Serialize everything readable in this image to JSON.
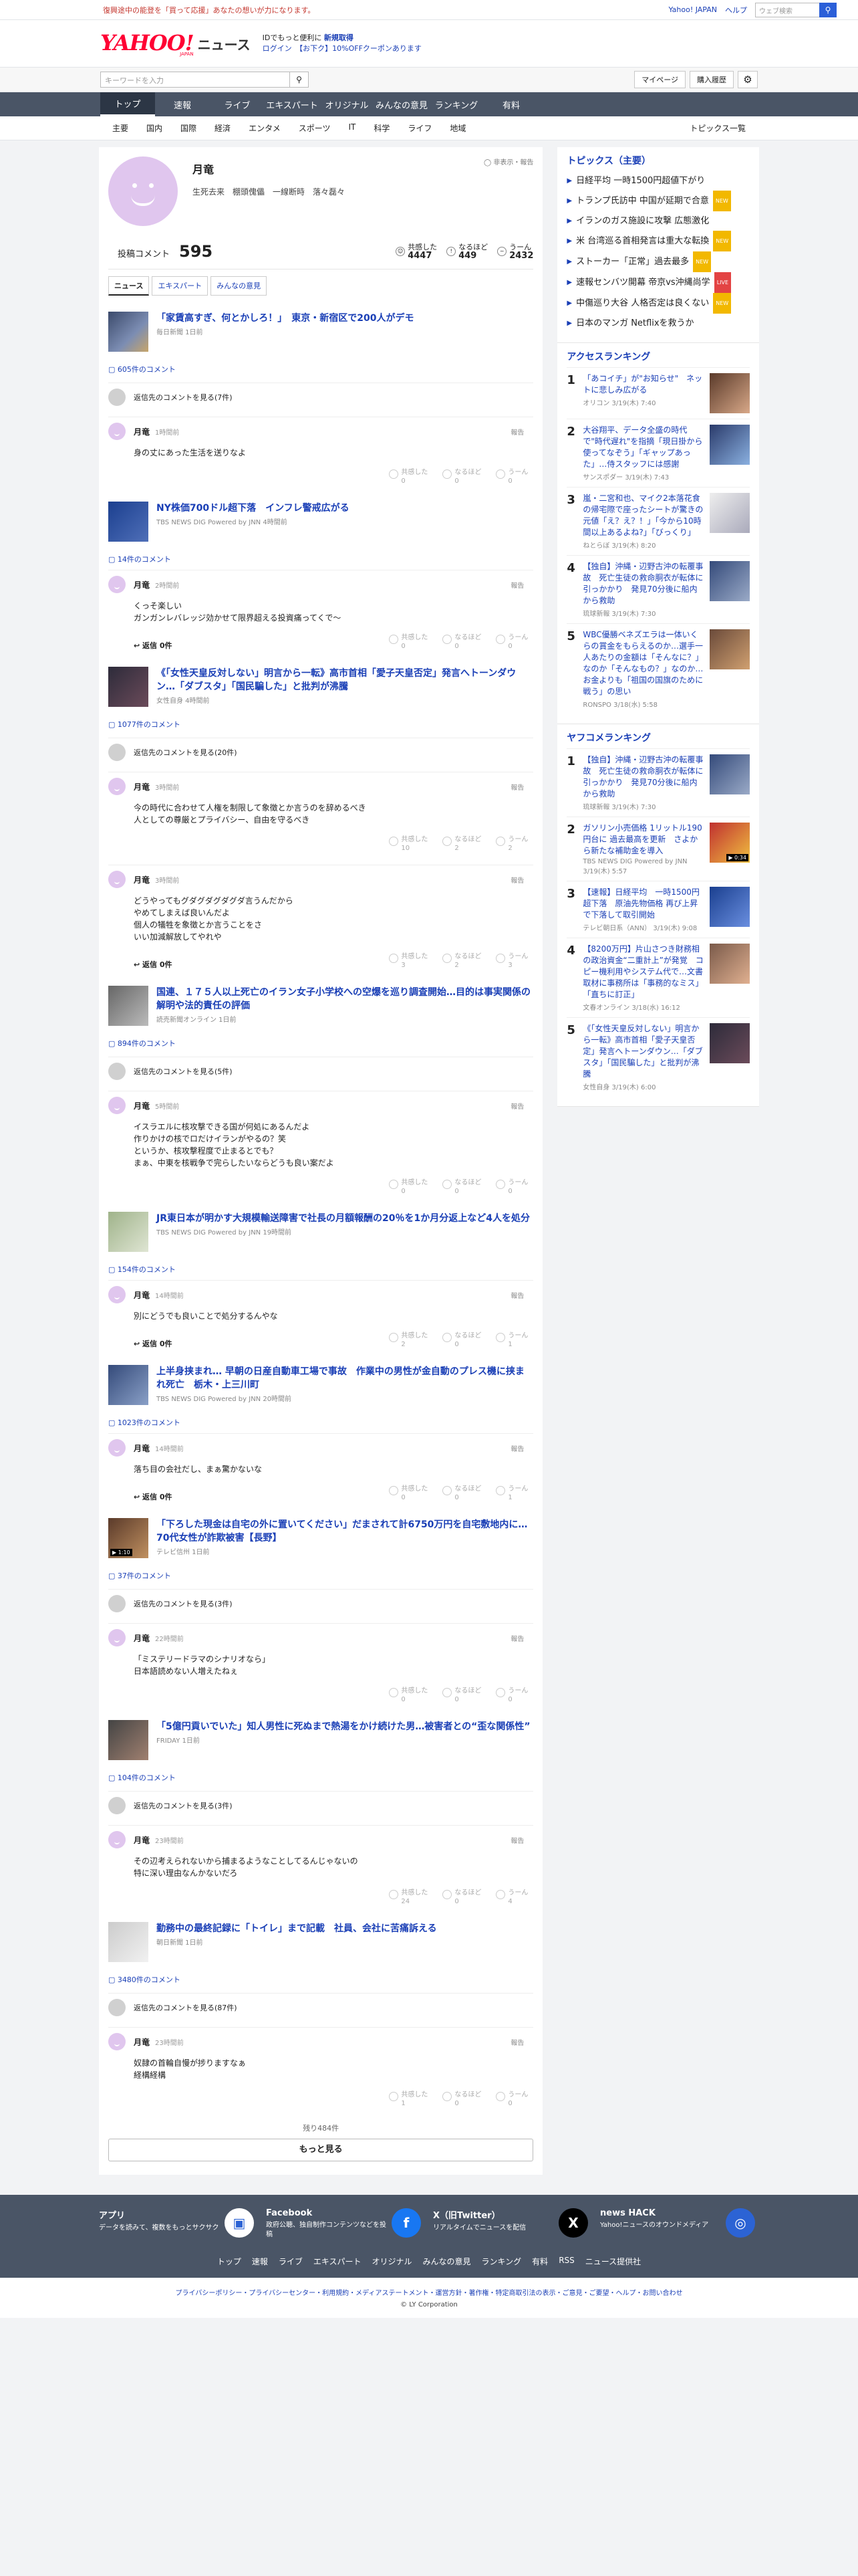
{
  "topbar": {
    "notice": "復興途中の能登を「買って応援」あなたの想いが力になります。",
    "yahoo_japan": "Yahoo! JAPAN",
    "help": "ヘルプ",
    "search_placeholder": "ウェブ検索",
    "search_btn": "Q"
  },
  "masthead": {
    "logo_text": "YAHOO!",
    "logo_sub": "JAPAN",
    "service": "ニュース",
    "promo_line1_prefix": "IDでもっと便利に",
    "promo_line1_link": "新規取得",
    "promo_login": "ログイン",
    "promo_offer": "【お下ク】10%OFFクーポンあります"
  },
  "searchbar": {
    "placeholder": "キーワードを入力",
    "my_page": "マイページ",
    "history": "購入履歴"
  },
  "global_nav": [
    "トップ",
    "速報",
    "ライブ",
    "エキスパート",
    "オリジナル",
    "みんなの意見",
    "ランキング",
    "有料"
  ],
  "sub_nav": [
    "主要",
    "国内",
    "国際",
    "経済",
    "エンタメ",
    "スポーツ",
    "IT",
    "科学",
    "ライフ",
    "地域"
  ],
  "sub_nav_right": "トピックス一覧",
  "profile": {
    "name": "月竜",
    "tagline": "生死去来　棚頭傀儡　一線断時　落々磊々",
    "privacy": "非表示・報告",
    "comment_label": "投稿コメント",
    "comment_count": "595",
    "reactions": [
      {
        "label": "共感した",
        "value": "4447"
      },
      {
        "label": "なるほど",
        "value": "449"
      },
      {
        "label": "うーん",
        "value": "2432"
      }
    ]
  },
  "tabs": [
    "ニュース",
    "エキスパート",
    "みんなの意見"
  ],
  "articles": [
    {
      "title": "「家賃高すぎ、何とかしろ！」　東京・新宿区で200人がデモ",
      "source": "毎日新聞 1日前",
      "count": "605件のコメント",
      "reply_view": "返信先のコメントを見る(7件)",
      "comments": [
        {
          "name": "月竜",
          "time": "1時間前",
          "text": "身の丈にあった生活を送りなよ",
          "reply": "",
          "r": [
            "0",
            "0",
            "0"
          ]
        }
      ]
    },
    {
      "title": "NY株価700ドル超下落　インフレ警戒広がる",
      "source": "TBS NEWS DIG Powered by JNN 4時間前",
      "count": "14件のコメント",
      "reply_view": "",
      "comments": [
        {
          "name": "月竜",
          "time": "2時間前",
          "text": "くっそ楽しい\nガンガンレバレッジ効かせて限界超える投資痛ってくで〜",
          "reply": "返信 0件",
          "r": [
            "0",
            "0",
            "0"
          ]
        }
      ]
    },
    {
      "title": "《「女性天皇反対しない」明言から一転》高市首相「愛子天皇否定」発言へトーンダウン…「ダブスタ」「国民騙した」と批判が沸騰",
      "source": "女性自身 4時間前",
      "count": "1077件のコメント",
      "reply_view": "返信先のコメントを見る(20件)",
      "comments": [
        {
          "name": "月竜",
          "time": "3時間前",
          "text": "今の時代に合わせて人権を制限して象徴とか言うのを辞めるべき\n人としての尊厳とプライバシー、自由を守るべき",
          "reply": "",
          "r": [
            "10",
            "2",
            "2"
          ]
        },
        {
          "name": "月竜",
          "time": "3時間前",
          "text": "どうやってもグダグダグダグダ言うんだから\nやめてしまえば良いんだよ\n個人の犠牲を象徴とか言うことをさ\nいい加減解放してやれや",
          "reply": "返信 0件",
          "r": [
            "3",
            "2",
            "3"
          ]
        }
      ]
    },
    {
      "title": "国連、１７５人以上死亡のイラン女子小学校への空爆を巡り調査開始…目的は事実関係の解明や法的責任の評価",
      "source": "読売新聞オンライン 1日前",
      "count": "894件のコメント",
      "reply_view": "返信先のコメントを見る(5件)",
      "comments": [
        {
          "name": "月竜",
          "time": "5時間前",
          "text": "イスラエルに核攻撃できる国が何処にあるんだよ\n作りかけの核でロだけイランがやるの？笑\nというか、核攻撃程度で止まるとでも？\nまぁ、中東を核戦争で完らしたいならどうも良い案だよ",
          "reply": "",
          "r": [
            "0",
            "0",
            "0"
          ]
        }
      ]
    },
    {
      "title": "JR東日本が明かす大規模輸送障害で社長の月額報酬の20％を1か月分返上など4人を処分",
      "source": "TBS NEWS DIG Powered by JNN 19時間前",
      "count": "154件のコメント",
      "reply_view": "",
      "comments": [
        {
          "name": "月竜",
          "time": "14時間前",
          "text": "別にどうでも良いことで処分するんやな",
          "reply": "返信 0件",
          "r": [
            "2",
            "0",
            "1"
          ]
        }
      ]
    },
    {
      "title": "上半身挟まれ… 早朝の日産自動車工場で事故　作業中の男性が金自動のプレス機に挟まれ死亡　栃木・上三川町",
      "source": "TBS NEWS DIG Powered by JNN 20時間前",
      "count": "1023件のコメント",
      "reply_view": "",
      "comments": [
        {
          "name": "月竜",
          "time": "14時間前",
          "text": "落ち目の会社だし、まぁ驚かないな",
          "reply": "返信 0件",
          "r": [
            "0",
            "0",
            "1"
          ]
        }
      ]
    },
    {
      "title": "「下ろした現金は自宅の外に置いてください」だまされて計6750万円を自宅敷地内に…70代女性が詐欺被害【長野】",
      "source": "テレビ信州 1日前",
      "count": "37件のコメント",
      "reply_view": "返信先のコメントを見る(3件)",
      "comments": [
        {
          "name": "月竜",
          "time": "22時間前",
          "text": "「ミステリードラマのシナリオなら」\n日本語読めない人増えたねぇ",
          "reply": "",
          "r": [
            "0",
            "0",
            "0"
          ]
        }
      ]
    },
    {
      "title": "「5億円貢いでいた」知人男性に死ぬまで熱湯をかけ続けた男…被害者との“歪な関係性”",
      "source": "FRIDAY 1日前",
      "count": "104件のコメント",
      "reply_view": "返信先のコメントを見る(3件)",
      "comments": [
        {
          "name": "月竜",
          "time": "23時間前",
          "text": "その辺考えられないから捕まるようなことしてるんじゃないの\n特に深い理由なんかないだろ",
          "reply": "",
          "r": [
            "24",
            "0",
            "4"
          ]
        }
      ]
    },
    {
      "title": "勤務中の最終記録に「トイレ」まで記載　社員、会社に苦痛訴える",
      "source": "朝日新聞 1日前",
      "count": "3480件のコメント",
      "reply_view": "返信先のコメントを見る(87件)",
      "comments": [
        {
          "name": "月竜",
          "time": "23時間前",
          "text": "奴隷の首輪自慢が捗りますなぁ\n経構経構",
          "reply": "",
          "r": [
            "1",
            "0",
            "0"
          ]
        }
      ]
    }
  ],
  "reaction_labels": [
    "共感した",
    "なるほど",
    "うーん"
  ],
  "report": "報告",
  "more": {
    "remaining": "残り484件",
    "button": "もっと見る"
  },
  "topics": {
    "header": "トピックス（主要）",
    "items": [
      {
        "t": "日経平均 一時1500円超値下がり",
        "b": ""
      },
      {
        "t": "トランプ氏訪中 中国が延期で合意",
        "b": "NEW"
      },
      {
        "t": "イランのガス施設に攻撃 広態激化",
        "b": ""
      },
      {
        "t": "米 台湾巡る首相発言は重大な転換",
        "b": "NEW"
      },
      {
        "t": "ストーカー「正常」過去最多",
        "b": "NEW"
      },
      {
        "t": "速報センバツ開幕 帝京vs沖縄尚学",
        "b": "LIVE"
      },
      {
        "t": "中傷巡り大谷 人格否定は良くない",
        "b": "NEW"
      },
      {
        "t": "日本のマンガ Netflixを救うか",
        "b": ""
      }
    ]
  },
  "access_ranking": {
    "header": "アクセスランキング",
    "items": [
      {
        "n": "1",
        "t": "「あコイチ」が\"お知らせ\"　ネットに悲しみ広がる",
        "s": "オリコン 3/19(木) 7:40"
      },
      {
        "n": "2",
        "t": "大谷翔平、データ全盛の時代で\"時代遅れ\"を指摘「現日掛から使ってなぞう」「ギャップあった」…侍スタッフには感謝",
        "s": "サンスポダー 3/19(木) 7:43"
      },
      {
        "n": "3",
        "t": "嵐・二宮和也、マイク2本落花食の帰宅際で座ったシートが驚きの元値「え？え？！」「今から10時間以上あるよね?」「びっくり」",
        "s": "ねとらぼ 3/19(木) 8:20"
      },
      {
        "n": "4",
        "t": "【独自】沖縄・辺野古沖の転覆事故　死亡生徒の救命胴衣が転体に引っかかり　発見70分後に船内から救助",
        "s": "琉球新報 3/19(木) 7:30"
      },
      {
        "n": "5",
        "t": "WBC優勝ベネズエラは一体いくらの賞金をもらえるのか…選手一人あたりの金額は「そんなに？」なのか「そんなもの？」なのか…お金よりも「祖国の国旗のために戦う」の思い",
        "s": "RONSPO 3/18(水) 5:58"
      }
    ]
  },
  "yahoo_ranking": {
    "header": "ヤフコメランキング",
    "items": [
      {
        "n": "1",
        "t": "【独自】沖縄・辺野古沖の転覆事故　死亡生徒の救命胴衣が転体に引っかかり　発見70分後に船内から救助",
        "s": "琉球新報 3/19(木) 7:30"
      },
      {
        "n": "2",
        "t": "ガソリン小売価格 1リットル190円台に 過去最高を更新　さよから新たな補助金を導入",
        "s": "TBS NEWS DIG Powered by JNN 3/19(木) 5:57"
      },
      {
        "n": "3",
        "t": "【速報】日経平均　一時1500円超下落　原油先物価格 再び上昇で下落して取引開始",
        "s": "テレビ朝日系（ANN） 3/19(木) 9:08"
      },
      {
        "n": "4",
        "t": "【8200万円】片山さつき財務相の政治資金“二重計上”が発覚　コピー機利用やシステム代で…文書取材に事務所は「事務的なミス」「直ちに訂正」",
        "s": "文春オンライン 3/18(水) 16:12"
      },
      {
        "n": "5",
        "t": "《「女性天皇反対しない」明言から一転》高市首相「愛子天皇否定」発言へトーンダウン…「ダブスタ」「国民騙した」と批判が沸騰",
        "s": "女性自身 3/19(木) 6:00"
      }
    ]
  },
  "footer": {
    "apps": [
      {
        "name": "アプリ",
        "desc": "データを読みて、複数をもっとサクサク",
        "icon": "app-icon",
        "color": "#ffffff"
      },
      {
        "name": "Facebook",
        "desc": "政府公聴、独自制作コンテンツなどを投稿",
        "icon": "facebook-icon",
        "color": "#1877f2"
      },
      {
        "name": "X（旧Twitter）",
        "desc": "リアルタイムでニュースを配信",
        "icon": "x-icon",
        "color": "#000000"
      },
      {
        "name": "news HACK",
        "desc": "Yahoo!ニュースのオウンドメディア",
        "icon": "newshack-icon",
        "color": "#2c63d4"
      }
    ],
    "links": [
      "トップ",
      "速報",
      "ライブ",
      "エキスパート",
      "オリジナル",
      "みんなの意見",
      "ランキング",
      "有料",
      "RSS",
      "ニュース提供社"
    ],
    "legal": "プライバシーポリシー・プライバシーセンター・利用規約・メディアステートメント・運営方針・著作権・特定商取引法の表示・ご意見・ご要望・ヘルプ・お問い合わせ",
    "copyright": "© LY Corporation"
  }
}
